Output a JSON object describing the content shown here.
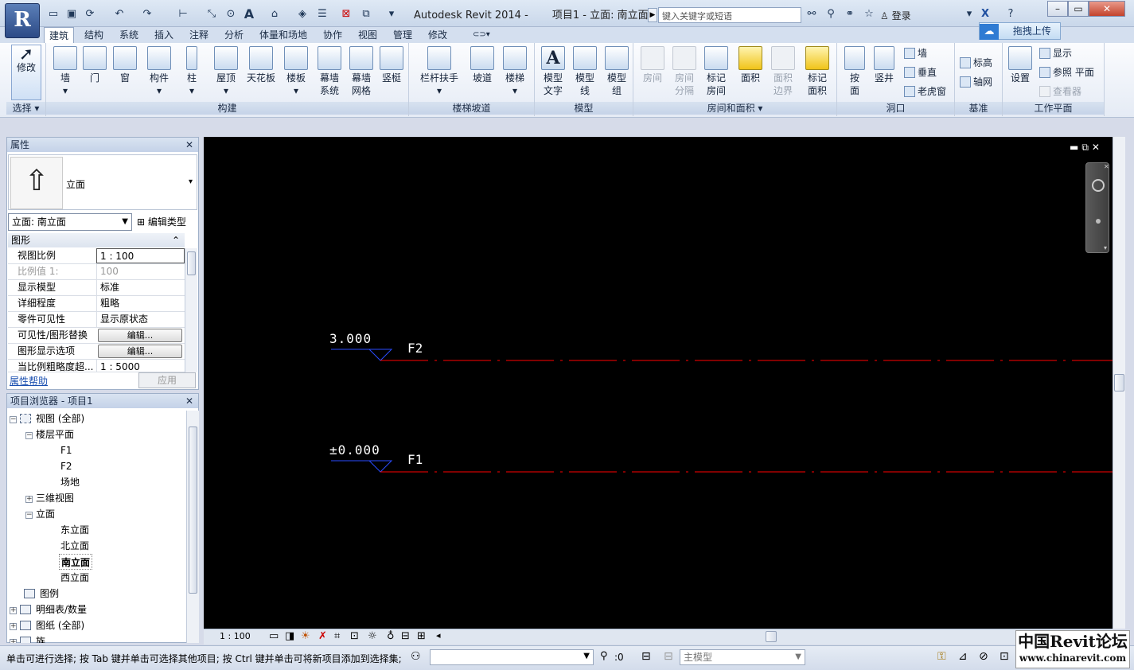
{
  "title_bar": {
    "app_title": "Autodesk Revit 2014 -",
    "doc_title": "项目1 - 立面: 南立面",
    "search_placeholder": "键入关键字或短语",
    "login_label": "登录"
  },
  "app_button_letter": "R",
  "ribbon_tabs": [
    "建筑",
    "结构",
    "系统",
    "插入",
    "注释",
    "分析",
    "体量和场地",
    "协作",
    "视图",
    "管理",
    "修改"
  ],
  "cloud_upload_label": "拖拽上传",
  "ribbon": {
    "select_panel": {
      "modify_label": "修改",
      "header": "选择 ▾"
    },
    "build_panel": {
      "header": "构建",
      "buttons": [
        "墙",
        "门",
        "窗",
        "构件",
        "柱",
        "屋顶",
        "天花板",
        "楼板",
        "幕墙\n系统",
        "幕墙\n网格",
        "竖梃"
      ]
    },
    "stair_panel": {
      "header": "楼梯坡道",
      "buttons": [
        "栏杆扶手",
        "坡道",
        "楼梯"
      ]
    },
    "model_panel": {
      "header": "模型",
      "buttons": [
        "模型\n文字",
        "模型\n线",
        "模型\n组"
      ]
    },
    "room_panel": {
      "header": "房间和面积 ▾",
      "buttons": [
        "房间",
        "房间\n分隔",
        "标记\n房间",
        "面积",
        "面积\n边界",
        "标记\n面积"
      ]
    },
    "opening_panel": {
      "header": "洞口",
      "big_buttons": [
        "按\n面",
        "竖井"
      ],
      "small_buttons": [
        "墙",
        "垂直",
        "老虎窗"
      ]
    },
    "datum_panel": {
      "header": "基准",
      "small_buttons": [
        "标高",
        "轴网"
      ]
    },
    "workplane_panel": {
      "header": "工作平面",
      "set_label": "设置",
      "small_buttons": [
        "显示",
        "参照 平面",
        "查看器"
      ]
    }
  },
  "properties": {
    "header": "属性",
    "type_name": "立面",
    "view_selector": "立面: 南立面",
    "edit_type_label": "编辑类型",
    "section_label": "图形",
    "rows": [
      {
        "key": "视图比例",
        "value": "1 : 100"
      },
      {
        "key": "比例值 1:",
        "value": "100"
      },
      {
        "key": "显示模型",
        "value": "标准"
      },
      {
        "key": "详细程度",
        "value": "粗略"
      },
      {
        "key": "零件可见性",
        "value": "显示原状态"
      },
      {
        "key": "可见性/图形替换",
        "value": "编辑..."
      },
      {
        "key": "图形显示选项",
        "value": "编辑..."
      },
      {
        "key": "当比例粗略度超...",
        "value": "1 : 5000"
      }
    ],
    "help_label": "属性帮助",
    "apply_label": "应用"
  },
  "browser": {
    "header": "项目浏览器 - 项目1",
    "nodes": [
      {
        "label": "视图 (全部)",
        "toggle": "−"
      },
      {
        "label": "楼层平面",
        "toggle": "−"
      },
      {
        "label": "F1",
        "toggle": ""
      },
      {
        "label": "F2",
        "toggle": ""
      },
      {
        "label": "场地",
        "toggle": ""
      },
      {
        "label": "三维视图",
        "toggle": "+"
      },
      {
        "label": "立面",
        "toggle": "−"
      },
      {
        "label": "东立面",
        "toggle": ""
      },
      {
        "label": "北立面",
        "toggle": ""
      },
      {
        "label": "南立面",
        "toggle": ""
      },
      {
        "label": "西立面",
        "toggle": ""
      },
      {
        "label": "图例",
        "toggle": ""
      },
      {
        "label": "明细表/数量",
        "toggle": "+"
      },
      {
        "label": "图纸 (全部)",
        "toggle": "+"
      },
      {
        "label": "族",
        "toggle": "+"
      }
    ]
  },
  "canvas": {
    "levels": [
      {
        "name": "F2",
        "elevation": "3.000"
      },
      {
        "name": "F1",
        "elevation": "±0.000"
      }
    ],
    "level_line_color": "#ff0000",
    "marker_color": "#2a4bff"
  },
  "view_control_bar": {
    "scale": "1 : 100"
  },
  "status_bar": {
    "message": "单击可进行选择; 按 Tab 键并单击可选择其他项目; 按 Ctrl 键并单击可将新项目添加到选择集;",
    "filter_count": ":0",
    "workset": "主模型"
  },
  "watermark": {
    "text_top": "中国Revit论坛",
    "text_bottom": "www.chinarevit.com"
  }
}
